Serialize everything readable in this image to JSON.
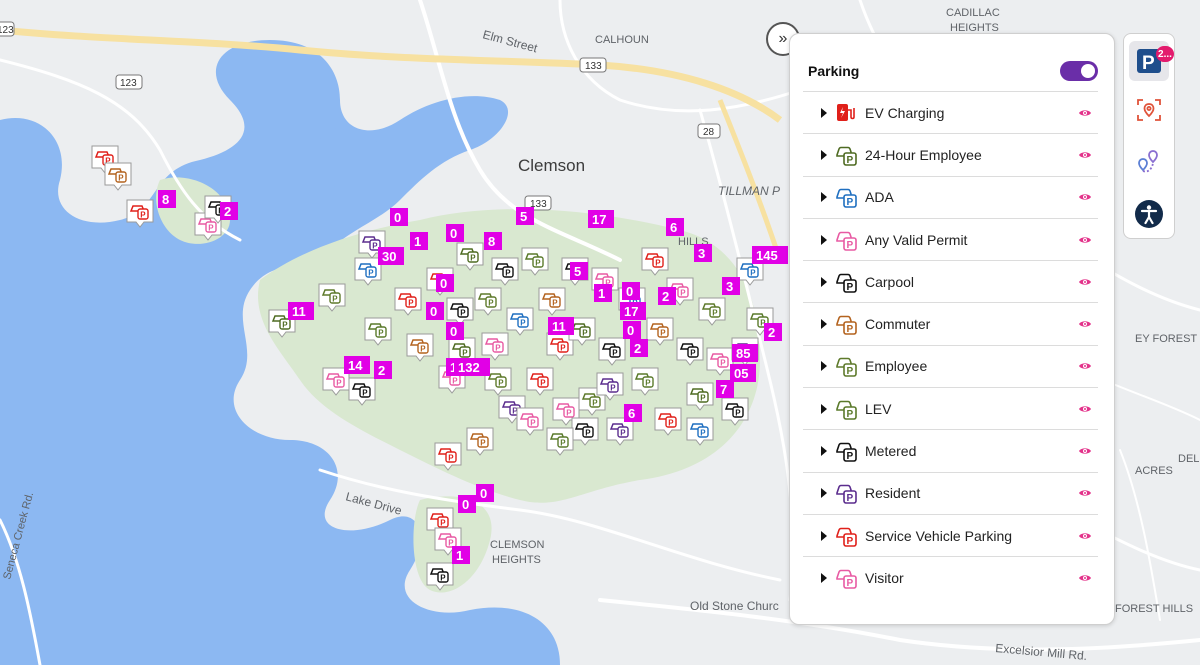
{
  "map": {
    "place_labels": [
      "Elm Street",
      "CALHOUN",
      "CADILLAC",
      "HEIGHTS",
      "Clemson",
      "TILLMAN P",
      "EY FOREST",
      "ACRES",
      "DEL",
      "Lake Drive",
      "CLEMSON",
      "HEIGHTS",
      "Old Stone Churc",
      "FOREST HILLS",
      "Excelsior Mill Rd.",
      "Seneca Creek Rd.",
      "HILLS"
    ],
    "route_shields": [
      "123",
      "123",
      "133",
      "133",
      "28"
    ],
    "cluster_counts": [
      "0",
      "5",
      "17",
      "6",
      "2",
      "8",
      "0",
      "30",
      "11",
      "1",
      "0",
      "5",
      "1",
      "0",
      "8",
      "145",
      "3",
      "2",
      "2",
      "3",
      "11",
      "0",
      "17",
      "0",
      "14",
      "2",
      "1",
      "132",
      "2",
      "85",
      "05",
      "7",
      "6",
      "0",
      "0",
      "0",
      "1"
    ],
    "colors": {
      "water": "#8cb8f2",
      "land": "#eceef0",
      "park": "#d9e8d0",
      "road": "#ffffff",
      "highway": "#f7e1a1",
      "cluster": "#e100e6"
    }
  },
  "collapse_button": {
    "icon": "double-chevron-right",
    "glyph": "»"
  },
  "panel": {
    "title": "Parking",
    "toggle_on": true,
    "layers": [
      {
        "label": "EV Charging",
        "icon": "ev-charging-icon",
        "color": "#e0201a"
      },
      {
        "label": "24-Hour Employee",
        "icon": "parking-24h-employee-icon",
        "color": "#4f6b22"
      },
      {
        "label": "ADA",
        "icon": "parking-ada-icon",
        "color": "#1f6fc0"
      },
      {
        "label": "Any Valid Permit",
        "icon": "parking-any-permit-icon",
        "color": "#e85aa3"
      },
      {
        "label": "Carpool",
        "icon": "parking-carpool-icon",
        "color": "#111111"
      },
      {
        "label": "Commuter",
        "icon": "parking-commuter-icon",
        "color": "#b4631f"
      },
      {
        "label": "Employee",
        "icon": "parking-employee-icon",
        "color": "#5e7a2b"
      },
      {
        "label": "LEV",
        "icon": "parking-lev-icon",
        "color": "#5a7a2b"
      },
      {
        "label": "Metered",
        "icon": "parking-metered-icon",
        "color": "#111111"
      },
      {
        "label": "Resident",
        "icon": "parking-resident-icon",
        "color": "#5b2d8e"
      },
      {
        "label": "Service Vehicle Parking",
        "icon": "parking-service-icon",
        "color": "#e0201a"
      },
      {
        "label": "Visitor",
        "icon": "parking-visitor-icon",
        "color": "#e85aa3"
      }
    ]
  },
  "toolbar": {
    "parking_badge": "2...",
    "buttons": [
      "parking-layer-icon",
      "location-scan-icon",
      "route-pins-icon",
      "accessibility-icon"
    ]
  }
}
